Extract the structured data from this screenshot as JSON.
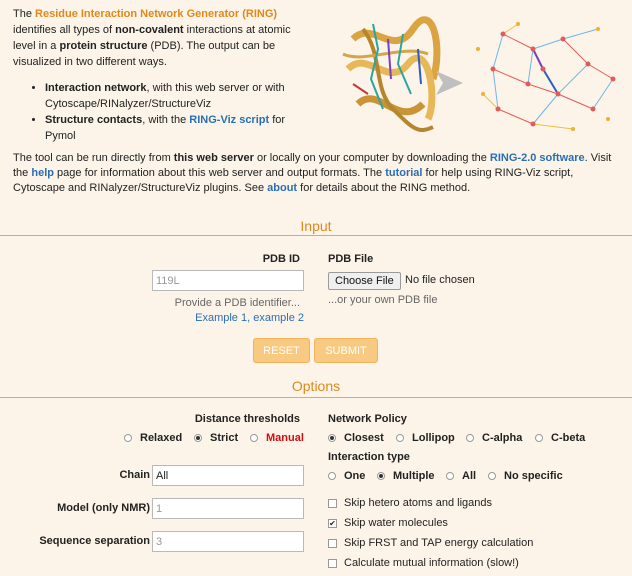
{
  "intro": {
    "p1_pre": "The ",
    "p1_link": "Residue Interaction Network Generator (RING)",
    "p1_mid1": " identifies all types of ",
    "p1_bold1": "non-covalent",
    "p1_mid2": " interactions at atomic level in a ",
    "p1_bold2": "protein structure",
    "p1_post": " (PDB). The output can be visualized in two different ways.",
    "li1_bold": "Interaction network",
    "li1_rest": ", with this web server or with Cytoscape/RINalyzer/StructureViz",
    "li2_bold": "Structure contacts",
    "li2_mid": ", with the ",
    "li2_link": "RING-Viz script",
    "li2_post": " for Pymol"
  },
  "desc": {
    "t1": "The tool can be run directly from ",
    "b1": "this web server",
    "t2": " or locally on your computer by downloading the ",
    "l1": "RING-2.0 software",
    "t3": ". Visit the ",
    "l2": "help",
    "t4": " page for information about this web server and output formats. The ",
    "l3": "tutorial",
    "t5": " for help using RING-Viz script, Cytoscape and RINalyzer/StructureViz plugins. See ",
    "l4": "about",
    "t6": " for details about the RING method."
  },
  "input": {
    "section_title": "Input",
    "pdb_id_label": "PDB ID",
    "pdb_id_placeholder": "119L",
    "pdb_id_hint": "Provide a PDB identifier...",
    "example1": "Example 1",
    "example_sep": ", ",
    "example2": "example 2",
    "pdb_file_label": "PDB File",
    "choose_file": "Choose File",
    "no_file": "No file chosen",
    "file_hint": "...or your own PDB file",
    "reset": "RESET",
    "submit": "SUBMIT"
  },
  "options": {
    "section_title": "Options",
    "distance_label": "Distance thresholds",
    "distance": [
      {
        "label": "Relaxed",
        "checked": false
      },
      {
        "label": "Strict",
        "checked": true
      },
      {
        "label": "Manual",
        "checked": false
      }
    ],
    "network_policy_label": "Network Policy",
    "network_policy": [
      {
        "label": "Closest",
        "checked": true
      },
      {
        "label": "Lollipop",
        "checked": false
      },
      {
        "label": "C-alpha",
        "checked": false
      },
      {
        "label": "C-beta",
        "checked": false
      }
    ],
    "interaction_type_label": "Interaction type",
    "interaction_type": [
      {
        "label": "One",
        "checked": false
      },
      {
        "label": "Multiple",
        "checked": true
      },
      {
        "label": "All",
        "checked": false
      },
      {
        "label": "No specific",
        "checked": false
      }
    ],
    "chain_label": "Chain",
    "chain_value": "All",
    "model_label": "Model (only NMR)",
    "model_placeholder": "1",
    "seqsep_label": "Sequence separation",
    "seqsep_placeholder": "3",
    "checkboxes": [
      {
        "label": "Skip hetero atoms and ligands",
        "checked": false
      },
      {
        "label": "Skip water molecules",
        "checked": true
      },
      {
        "label": "Skip FRST and TAP energy calculation",
        "checked": false
      },
      {
        "label": "Calculate mutual information (slow!)",
        "checked": false
      }
    ],
    "checkmark": "✔"
  },
  "colors": {
    "background": "#fcf4e8",
    "accent": "#e0891a",
    "link": "#2a6fb3",
    "button": "#f8c981",
    "rule": "#d9b24a",
    "manual": "#cc1111"
  }
}
